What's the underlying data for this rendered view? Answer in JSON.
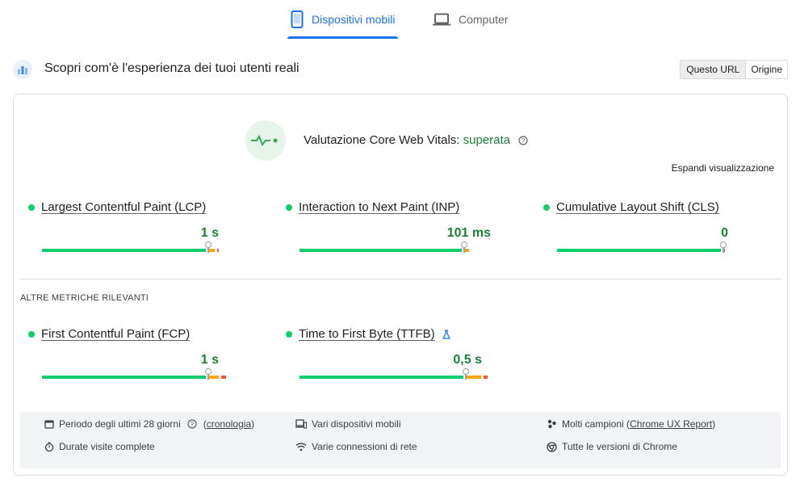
{
  "tabs": [
    {
      "label": "Dispositivi mobili",
      "active": true,
      "icon": "smartphone-icon"
    },
    {
      "label": "Computer",
      "active": false,
      "icon": "laptop-icon"
    }
  ],
  "header": {
    "title": "Scopri com'è l'esperienza dei tuoi utenti reali",
    "toggle": [
      "Questo URL",
      "Origine"
    ],
    "selected": "Questo URL"
  },
  "assessment": {
    "label": "Valutazione Core Web Vitals:",
    "status": "superata"
  },
  "expand_label": "Espandi visualizzazione",
  "core_metrics": [
    {
      "name": "Largest Contentful Paint (LCP)",
      "value": "1 s",
      "distribution": [
        0.74,
        0.04,
        0.02
      ],
      "marker": 0.74
    },
    {
      "name": "Interaction to Next Paint (INP)",
      "value": "101 ms",
      "distribution": [
        0.74,
        0.03,
        0.0
      ],
      "marker": 0.74
    },
    {
      "name": "Cumulative Layout Shift (CLS)",
      "value": "0",
      "distribution": [
        0.74,
        0.0,
        0.01
      ],
      "marker": 0.74
    }
  ],
  "other_title": "ALTRE METRICHE RILEVANTI",
  "other_metrics": [
    {
      "name": "First Contentful Paint (FCP)",
      "value": "1 s",
      "distribution": [
        0.74,
        0.06,
        0.03
      ],
      "marker": 0.74,
      "experimental": false
    },
    {
      "name": "Time to First Byte (TTFB)",
      "value": "0,5 s",
      "distribution": [
        0.74,
        0.08,
        0.03
      ],
      "marker": 0.74,
      "experimental": true
    }
  ],
  "footer": {
    "period": "Periodo degli ultimi 28 giorni",
    "history_link": "cronologia",
    "durations": "Durate visite complete",
    "devices": "Vari dispositivi mobili",
    "network": "Varie connessioni di rete",
    "samples_prefix": "Molti campioni",
    "samples_link": "Chrome UX Report",
    "chrome": "Tutte le versioni di Chrome"
  },
  "colors": {
    "accent": "#1a73e8",
    "good": "#0cce6b",
    "needs_improvement": "#ffa400",
    "poor": "#ff4e42",
    "pass_text": "#188038"
  }
}
